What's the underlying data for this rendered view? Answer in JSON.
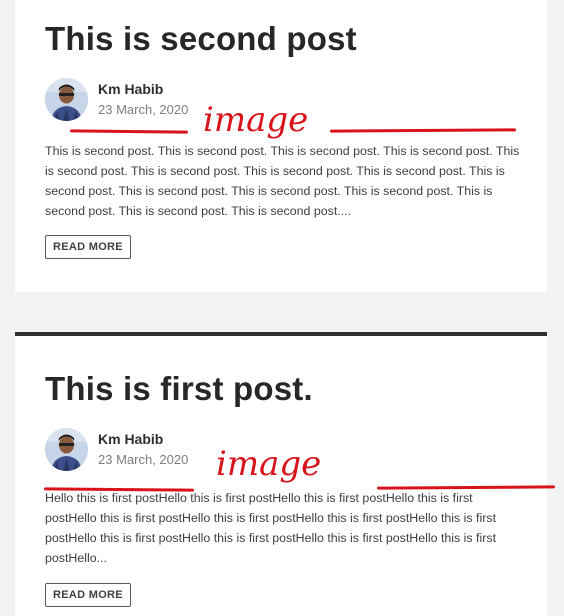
{
  "posts": [
    {
      "title": "This is second post",
      "author": "Km Habib",
      "date": "23 March, 2020",
      "excerpt": "This is second post. This is second post. This is second post. This is second post. This is second post. This is second post. This is second post. This is second post. This is second post. This is second post. This is second post. This is second post. This is second post. This is second post. This is second post....",
      "button": "READ MORE"
    },
    {
      "title": "This is first post.",
      "author": "Km Habib",
      "date": "23 March, 2020",
      "excerpt": "Hello this is first postHello this is first postHello this is first postHello this is first postHello this is first postHello this is first postHello this is first postHello this is first postHello this is first postHello this is first postHello this is first postHello this is first postHello...",
      "button": "READ MORE"
    }
  ],
  "annotations": {
    "label": "image",
    "color": "#d8141a"
  },
  "colors": {
    "background": "#f1f2f1",
    "card": "#ffffff",
    "title": "#24282a",
    "card_top_border": "#2d3133"
  },
  "icons": {
    "avatar": "author-photo"
  }
}
